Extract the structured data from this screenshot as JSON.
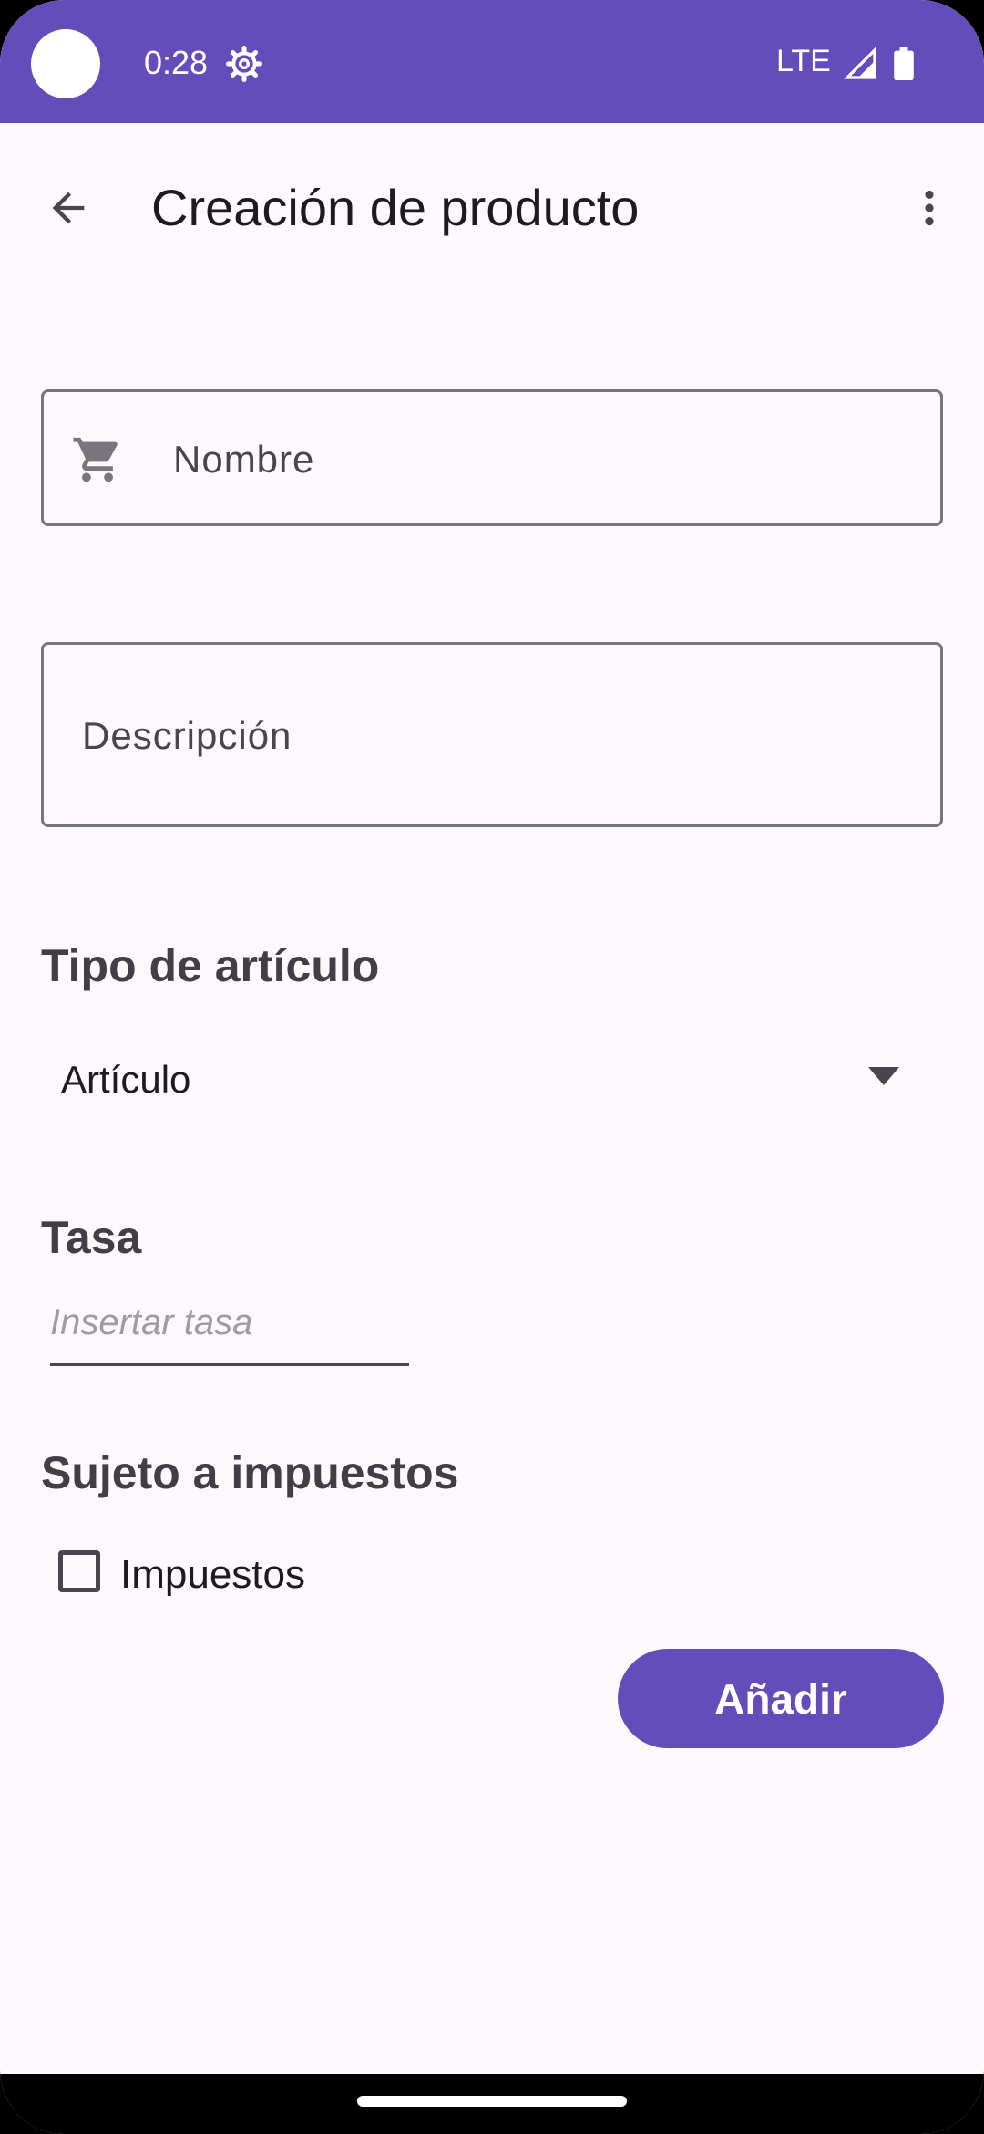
{
  "status_bar": {
    "time": "0:28",
    "network": "LTE",
    "icons": [
      "gear-icon",
      "signal-icon",
      "battery-icon"
    ]
  },
  "app_bar": {
    "title": "Creación de producto",
    "icons": [
      "arrow-back-icon",
      "more-vert-icon"
    ]
  },
  "form": {
    "name_field": {
      "placeholder": "Nombre",
      "value": "",
      "icon": "cart-icon"
    },
    "description_field": {
      "placeholder": "Descripción",
      "value": ""
    },
    "item_type": {
      "label": "Tipo de artículo",
      "selected": "Artículo"
    },
    "rate": {
      "label": "Tasa",
      "placeholder": "Insertar tasa",
      "value": ""
    },
    "taxable": {
      "label": "Sujeto a impuestos",
      "checkbox_label": "Impuestos",
      "checked": false
    },
    "submit_label": "Añadir"
  },
  "colors": {
    "primary": "#634dba",
    "background": "#fdf8fc",
    "outline": "#79747e"
  }
}
